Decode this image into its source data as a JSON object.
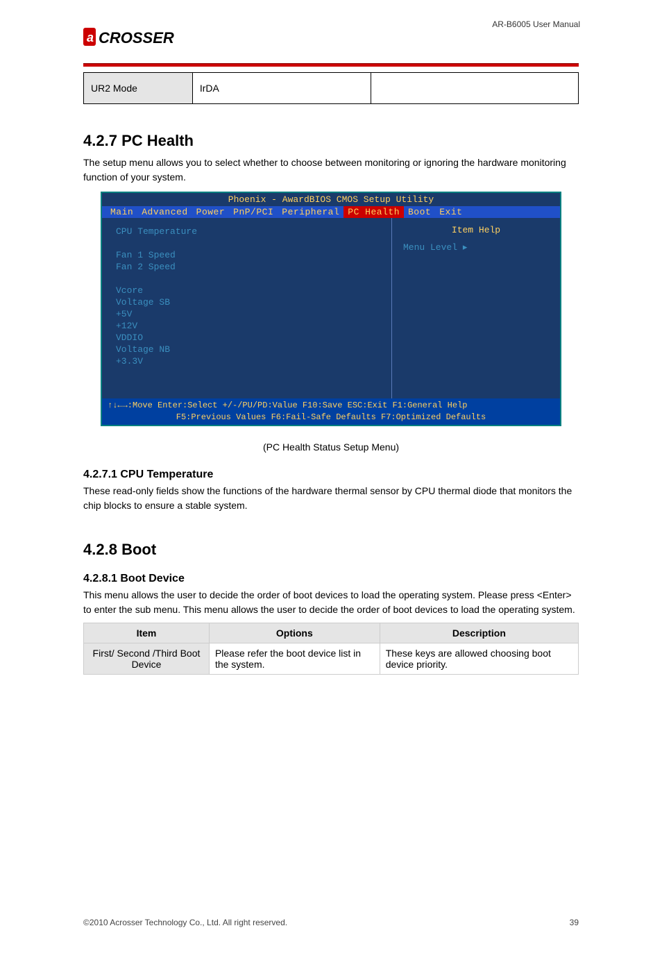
{
  "doc": {
    "product": "AR-B6005 User Manual",
    "logo_text": "CROSSER"
  },
  "table1": {
    "c1": "UR2 Mode",
    "c2": "IrDA",
    "c3": ""
  },
  "section": {
    "number": "4.2.7",
    "title": "PC Health",
    "para": "The setup menu allows you to select whether to choose between monitoring or ignoring the hardware monitoring function of your system."
  },
  "bios": {
    "title": "Phoenix - AwardBIOS CMOS Setup Utility",
    "menu": [
      "Main",
      "Advanced",
      "Power",
      "PnP/PCI",
      "Peripheral",
      "PC Health",
      "Boot",
      "Exit"
    ],
    "active": "PC Health",
    "left_items": [
      "CPU Temperature",
      "",
      "Fan 1 Speed",
      "Fan 2 Speed",
      "",
      "Vcore",
      "Voltage SB",
      "+5V",
      "+12V",
      "VDDIO",
      "Voltage NB",
      "+3.3V"
    ],
    "help_title": "Item Help",
    "menu_level": "Menu Level    ▸",
    "foot1": "↑↓←→:Move  Enter:Select  +/-/PU/PD:Value  F10:Save  ESC:Exit  F1:General Help",
    "foot2": "F5:Previous Values    F6:Fail-Safe Defaults    F7:Optimized Defaults"
  },
  "after_bios": {
    "line1": "(PC Health Status Setup Menu)",
    "subhead": "4.2.7.1 CPU Temperature",
    "para": "These read-only fields show the functions of the hardware thermal sensor by CPU thermal diode that monitors the chip blocks to ensure a stable system."
  },
  "boot_section": {
    "number": "4.2.8",
    "title": "Boot",
    "subhead": "4.2.8.1 Boot Device",
    "para": "This menu allows the user to decide the order of boot devices to load the operating system. Please press <Enter> to enter the sub menu. This menu allows the user to decide the order of boot devices to load the operating system."
  },
  "boot_table": {
    "headers": [
      "Item",
      "Options",
      "Description"
    ],
    "row": {
      "c1": "First/ Second /Third Boot Device",
      "c2": "Please refer the boot device list in the system.",
      "c3": "These keys are allowed choosing boot device priority."
    }
  },
  "footer": {
    "left": "©2010 Acrosser Technology Co., Ltd. All right reserved.",
    "right": "39"
  }
}
